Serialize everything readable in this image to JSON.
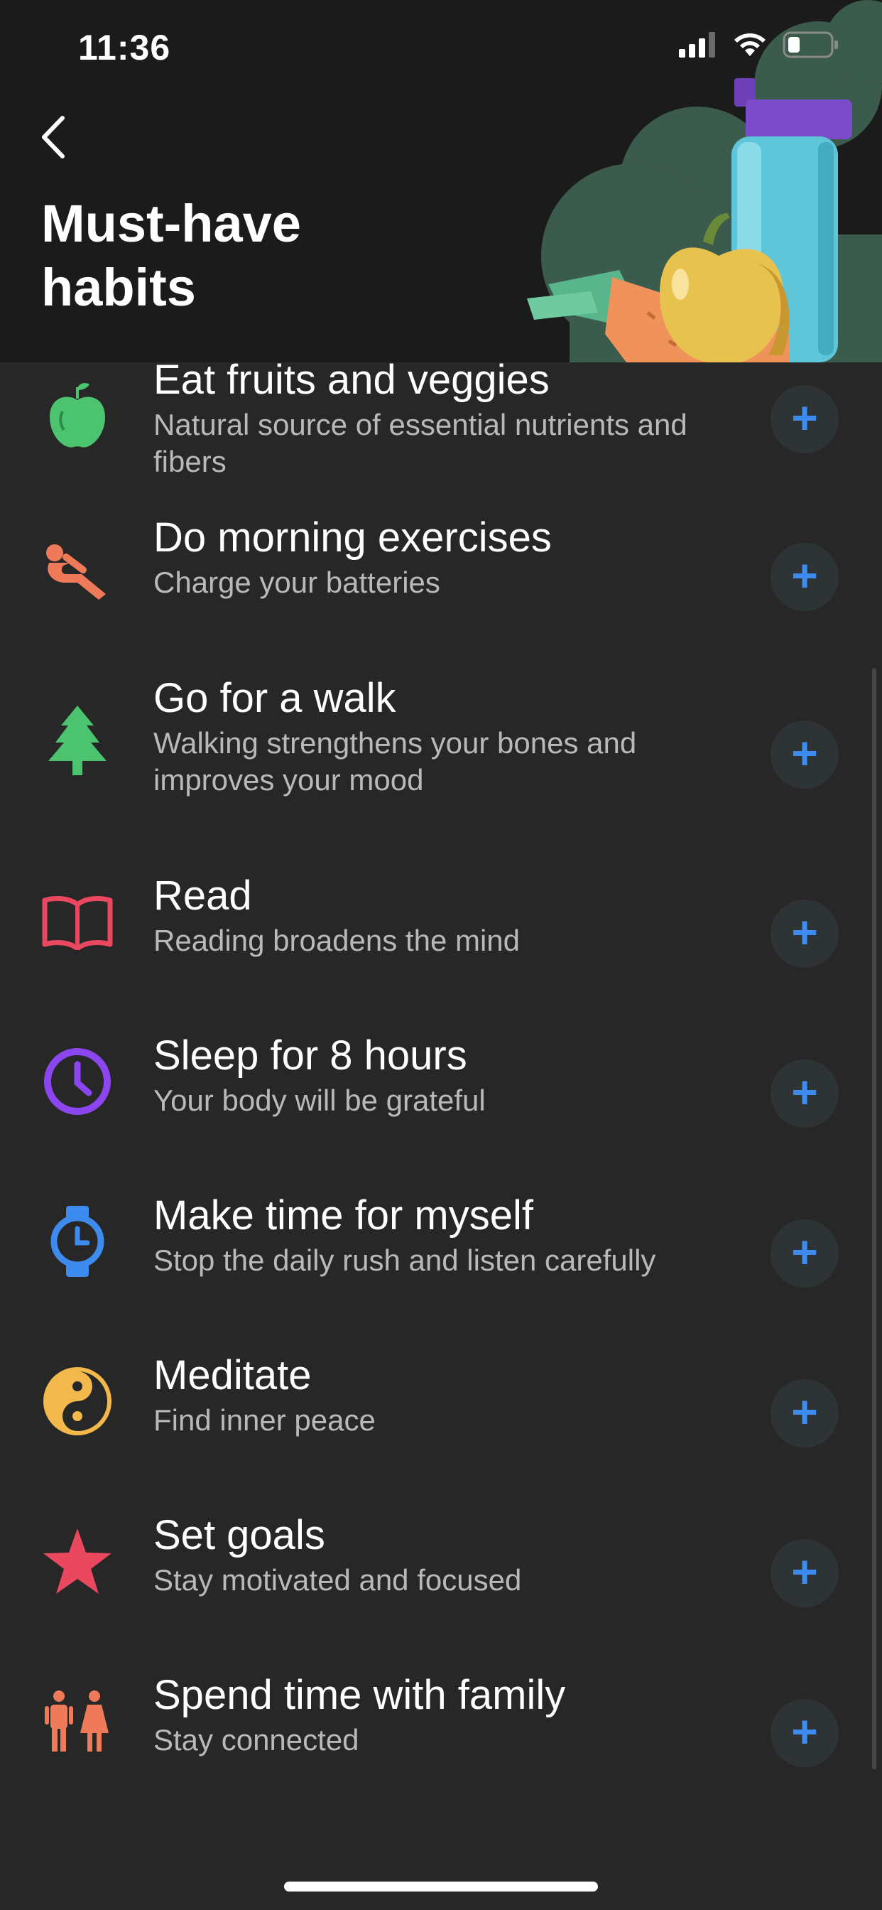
{
  "status_bar": {
    "time": "11:36"
  },
  "header": {
    "title": "Must-have habits"
  },
  "habits": [
    {
      "title": "Eat fruits and veggies",
      "subtitle": "Natural source of essential nutrients and fibers",
      "icon": "apple-icon",
      "color": "#4cc46f"
    },
    {
      "title": "Do morning exercises",
      "subtitle": "Charge your batteries",
      "icon": "situp-icon",
      "color": "#ef7a5a"
    },
    {
      "title": "Go for a walk",
      "subtitle": "Walking strengthens your bones and improves your mood",
      "icon": "tree-icon",
      "color": "#4cc46f"
    },
    {
      "title": "Read",
      "subtitle": "Reading broadens the mind",
      "icon": "book-icon",
      "color": "#e9485f"
    },
    {
      "title": "Sleep for 8 hours",
      "subtitle": "Your body will be grateful",
      "icon": "clock-icon",
      "color": "#8b46ef"
    },
    {
      "title": "Make time for myself",
      "subtitle": "Stop the daily rush and listen carefully",
      "icon": "watch-icon",
      "color": "#3d8bef"
    },
    {
      "title": "Meditate",
      "subtitle": "Find inner peace",
      "icon": "yin-yang-icon",
      "color": "#f2b84b"
    },
    {
      "title": "Set goals",
      "subtitle": "Stay motivated and focused",
      "icon": "star-icon",
      "color": "#e9485f"
    },
    {
      "title": "Spend time with family",
      "subtitle": "Stay connected",
      "icon": "family-icon",
      "color": "#ef7a5a"
    }
  ],
  "add_label": "+"
}
